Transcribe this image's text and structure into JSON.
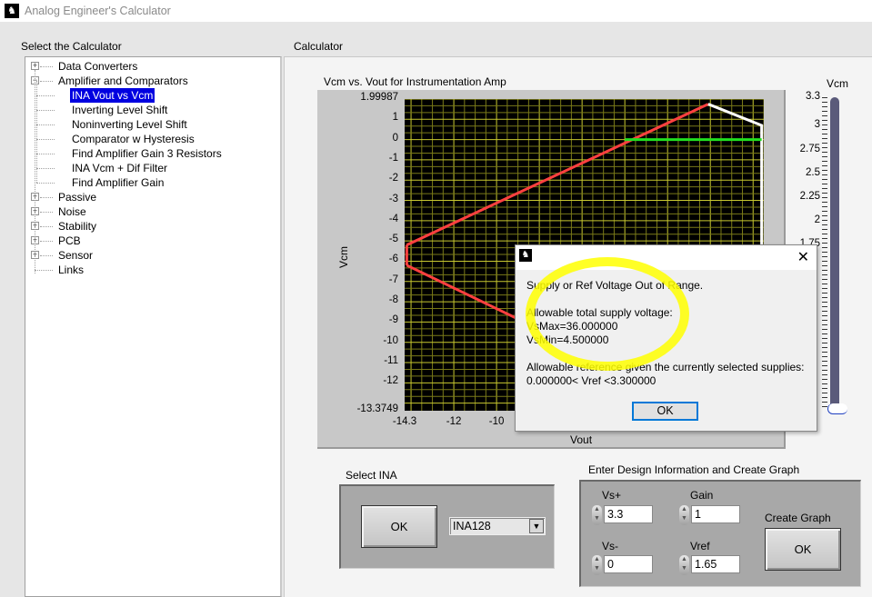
{
  "window": {
    "title": "Analog Engineer's Calculator",
    "logo_icon": "ti-logo-icon"
  },
  "left_panel": {
    "label": "Select the Calculator",
    "tree": [
      {
        "label": "Data Converters",
        "level": 0,
        "expander": "+"
      },
      {
        "label": "Amplifier and Comparators",
        "level": 0,
        "expander": "-"
      },
      {
        "label": "INA Vout vs Vcm",
        "level": 1,
        "selected": true
      },
      {
        "label": "Inverting Level Shift",
        "level": 1
      },
      {
        "label": "Noninverting Level Shift",
        "level": 1
      },
      {
        "label": "Comparator w Hysteresis",
        "level": 1
      },
      {
        "label": "Find Amplifier Gain 3 Resistors",
        "level": 1
      },
      {
        "label": "INA Vcm + Dif Filter",
        "level": 1
      },
      {
        "label": "Find Amplifier Gain",
        "level": 1
      },
      {
        "label": "Passive",
        "level": 0,
        "expander": "+"
      },
      {
        "label": "Noise",
        "level": 0,
        "expander": "+"
      },
      {
        "label": "Stability",
        "level": 0,
        "expander": "+"
      },
      {
        "label": "PCB",
        "level": 0,
        "expander": "+"
      },
      {
        "label": "Sensor",
        "level": 0,
        "expander": "+"
      },
      {
        "label": "Links",
        "level": 0
      }
    ]
  },
  "calculator": {
    "label": "Calculator",
    "slider": {
      "label": "Vcm",
      "ticks": [
        "3.3",
        "3",
        "2.75",
        "2.5",
        "2.25",
        "2",
        "1.75"
      ],
      "value": 0
    },
    "select_ina": {
      "label": "Select INA",
      "ok_label": "OK",
      "selected": "INA128"
    },
    "design": {
      "label": "Enter Design Information and Create Graph",
      "vs_plus": {
        "label": "Vs+",
        "value": "3.3"
      },
      "vs_minus": {
        "label": "Vs-",
        "value": "0"
      },
      "gain": {
        "label": "Gain",
        "value": "1"
      },
      "vref": {
        "label": "Vref",
        "value": "1.65"
      },
      "create_graph": {
        "label": "Create Graph",
        "ok_label": "OK"
      }
    }
  },
  "dialog": {
    "logo_icon": "ti-logo-icon",
    "close": "✕",
    "lines": [
      "Supply or Ref Voltage Out of Range.",
      "Allowable total supply voltage:",
      "VsMax=36.000000",
      "VsMin=4.500000",
      "Allowable reference given the currently selected supplies:",
      "0.000000< Vref <3.300000"
    ],
    "ok_label": "OK",
    "annotation": "yellow hand-drawn circle around supply voltage limits"
  },
  "chart_data": {
    "type": "line",
    "title": "Vcm vs. Vout for Instrumentation Amp",
    "xlabel": "Vout",
    "ylabel": "Vcm",
    "xlim": [
      -14.3,
      2.5
    ],
    "ylim": [
      -13.3749,
      1.99987
    ],
    "yticks": [
      "1.99987",
      "1",
      "0",
      "-1",
      "-2",
      "-3",
      "-4",
      "-5",
      "-6",
      "-7",
      "-8",
      "-9",
      "-10",
      "-11",
      "-12",
      "-13.3749"
    ],
    "xticks": [
      "-14.3",
      "-12",
      "-10"
    ],
    "grid": true,
    "colors": {
      "background": "#000000",
      "grid": "#a0a020",
      "red": "#ff4040",
      "white": "#ffffff",
      "green": "#20e020"
    },
    "series": [
      {
        "name": "upper-red",
        "color": "#ff4040",
        "x": [
          -14.2,
          -0.1
        ],
        "y": [
          -5.2,
          1.75
        ]
      },
      {
        "name": "left-red",
        "color": "#ff4040",
        "x": [
          -14.2,
          -14.2
        ],
        "y": [
          -5.2,
          -6.2
        ]
      },
      {
        "name": "lower-red",
        "color": "#ff4040",
        "x": [
          -14.2,
          -9.1
        ],
        "y": [
          -6.2,
          -8.8
        ]
      },
      {
        "name": "white",
        "color": "#ffffff",
        "x": [
          -0.1,
          2.4,
          2.4
        ],
        "y": [
          1.75,
          0.7,
          -13.3
        ]
      },
      {
        "name": "green",
        "color": "#20e020",
        "x": [
          -4.0,
          2.4
        ],
        "y": [
          0,
          0
        ]
      }
    ]
  }
}
